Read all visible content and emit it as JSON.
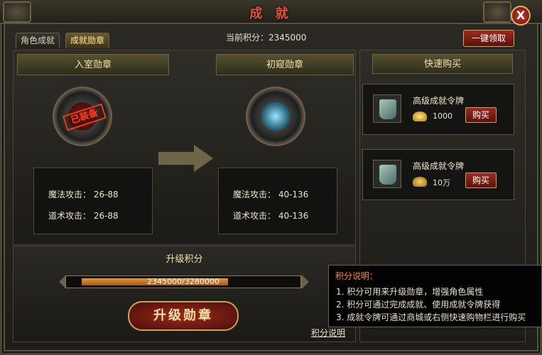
{
  "window": {
    "title": "成 就",
    "close_label": "X"
  },
  "tabs": [
    {
      "label": "角色成就",
      "active": false
    },
    {
      "label": "成就勋章",
      "active": true
    }
  ],
  "score": {
    "text": "当前积分：2345000"
  },
  "one_key_claim_label": "一键领取",
  "current_medal": {
    "header": "入室勋章",
    "stamp": "已装备",
    "stats": [
      "魔法攻击： 26-88",
      "道术攻击： 26-88"
    ]
  },
  "next_medal": {
    "header": "初窥勋章",
    "stats": [
      "魔法攻击： 40-136",
      "道术攻击： 40-136"
    ]
  },
  "upgrade": {
    "title": "升级积分",
    "progress_text": "2345000/3280000",
    "current": 2345000,
    "max": 3280000,
    "button_label": "升级勋章"
  },
  "shop": {
    "header": "快速购买",
    "items": [
      {
        "name": "高级成就令牌",
        "price": "1000",
        "buy_label": "购买",
        "currency_icon": "gold-ingot-icon"
      },
      {
        "name": "高级成就令牌",
        "price": "10万",
        "buy_label": "购买",
        "currency_icon": "bound-gold-ingot-icon"
      }
    ]
  },
  "tooltip": {
    "title": "积分说明：",
    "lines": [
      "1. 积分可用来升级勋章，增强角色属性",
      "2. 积分可通过完成成就、使用成就令牌获得",
      "3. 成就令牌可通过商城或右侧快速购物栏进行购买"
    ]
  },
  "explain_link": "积分说明",
  "colors": {
    "title": "#e0533a",
    "accent_gold": "#c8a256",
    "button_red": "#9a2a1e",
    "progress": "#e59a3a",
    "tooltip_title": "#ff8a30"
  }
}
